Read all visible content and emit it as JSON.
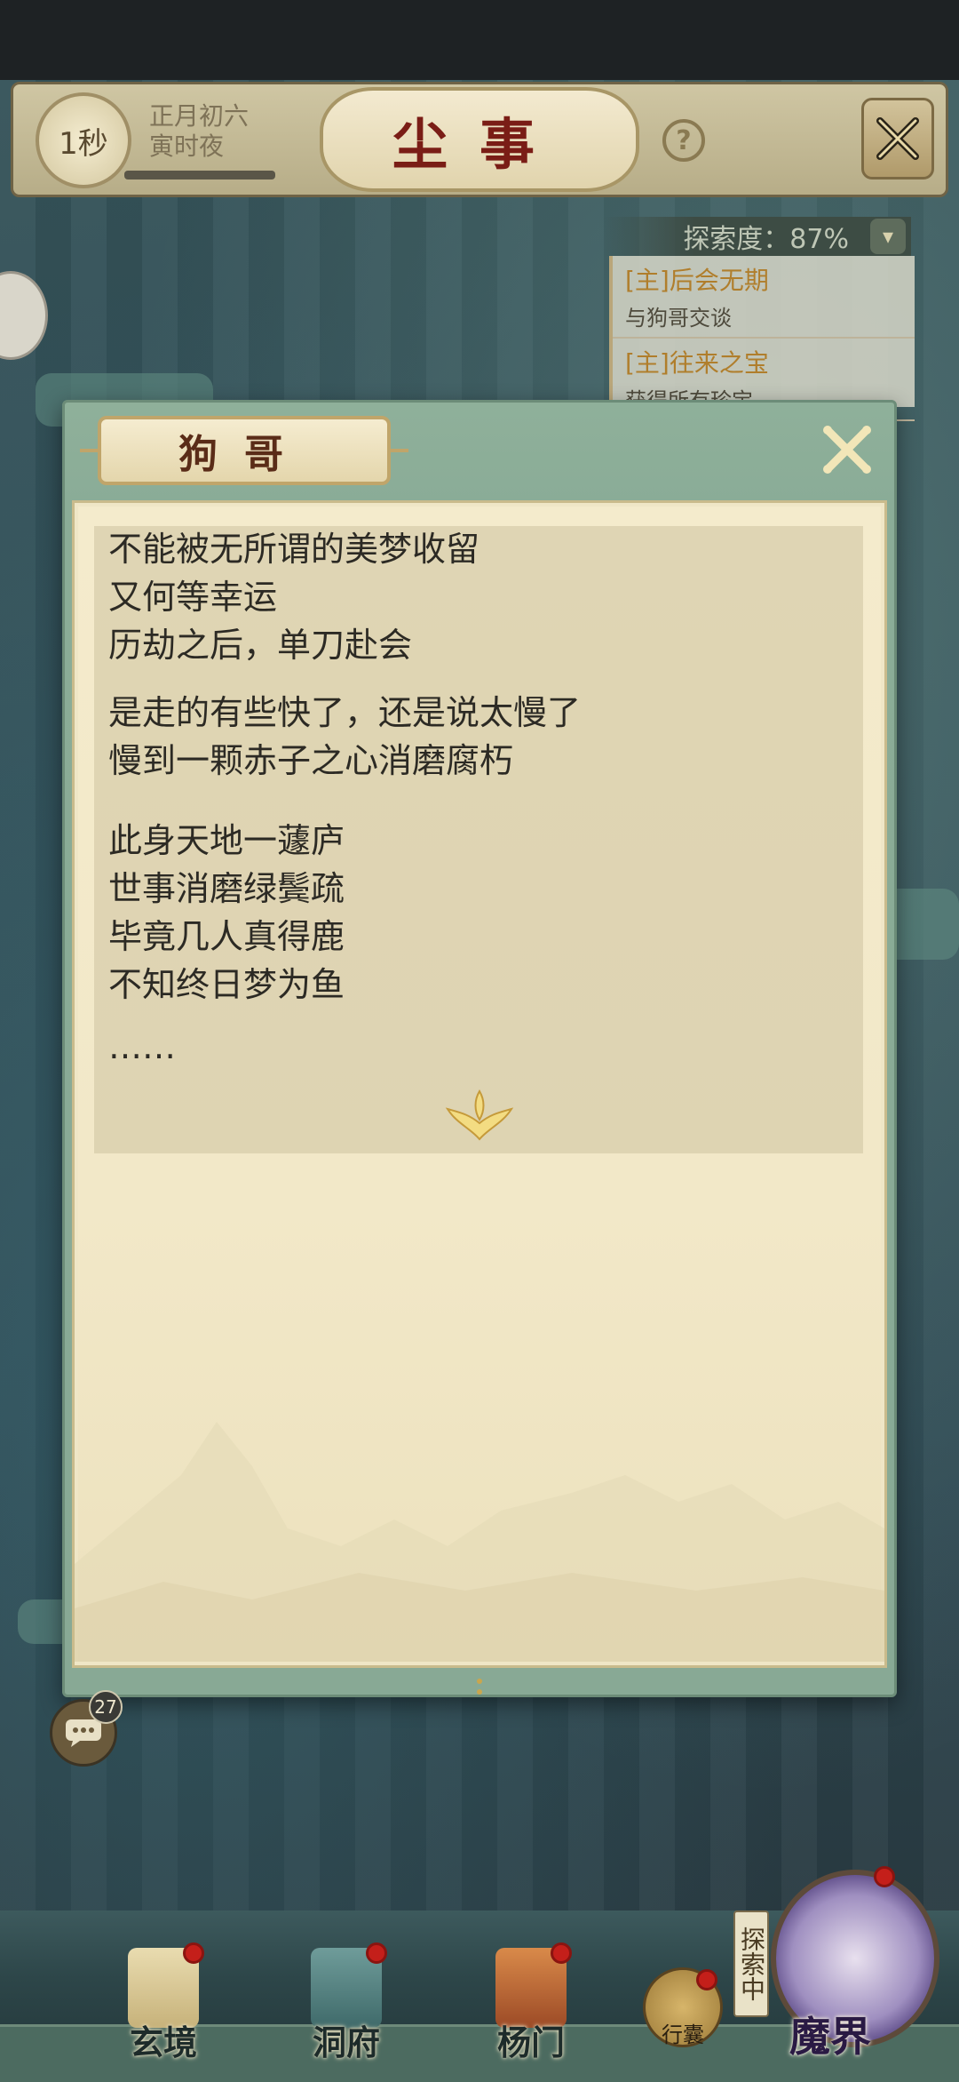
{
  "header": {
    "timer": "1秒",
    "date_line1": "正月初六",
    "date_line2": "寅时夜",
    "title": "尘事",
    "help": "?"
  },
  "exploration": {
    "label": "探索度：87%",
    "quests": [
      {
        "title": "[主]后会无期",
        "desc": "与狗哥交谈"
      },
      {
        "title": "[主]往来之宝",
        "desc": "获得所有珍宝"
      }
    ]
  },
  "dialog": {
    "speaker": "狗哥",
    "lines": [
      "不能被无所谓的美梦收留",
      "又何等幸运",
      "历劫之后，单刀赴会",
      "是走的有些快了，还是说太慢了",
      "慢到一颗赤子之心消磨腐朽",
      "此身天地一蘧庐",
      "世事消磨绿鬓疏",
      "毕竟几人真得鹿",
      "不知终日梦为鱼",
      "……"
    ]
  },
  "chat": {
    "count": "27"
  },
  "bottom_nav": {
    "items": [
      {
        "label": "玄境"
      },
      {
        "label": "洞府"
      },
      {
        "label": "杨门"
      }
    ],
    "bag_label": "行囊",
    "explore_tag": "探索中",
    "demon_label": "魔界"
  },
  "colors": {
    "title_red": "#7a1d16",
    "quest_gold": "#b07e2c",
    "dialog_green": "#8fb09a",
    "paper": "#f4ebcc",
    "badge_red": "#c41f1a"
  }
}
